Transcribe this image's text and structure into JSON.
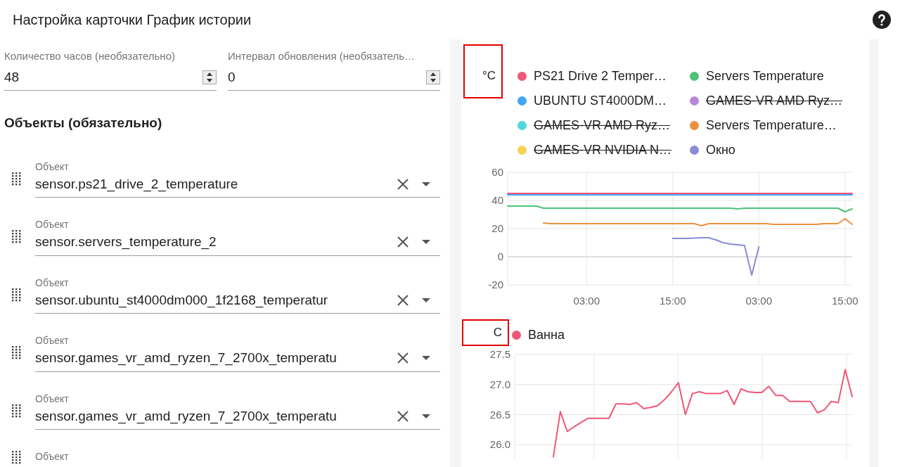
{
  "header": {
    "title": "Настройка карточки График истории"
  },
  "fields": [
    {
      "label": "Количество часов (необязательно)",
      "value": "48"
    },
    {
      "label": "Интервал обновления (необязатель…",
      "value": "0"
    }
  ],
  "entities_heading": "Объекты (обязательно)",
  "entities": [
    {
      "label": "Объект",
      "value": "sensor.ps21_drive_2_temperature"
    },
    {
      "label": "Объект",
      "value": "sensor.servers_temperature_2"
    },
    {
      "label": "Объект",
      "value": "sensor.ubuntu_st4000dm000_1f2168_temperatur"
    },
    {
      "label": "Объект",
      "value": "sensor.games_vr_amd_ryzen_7_2700x_temperatu"
    },
    {
      "label": "Объект",
      "value": "sensor.games_vr_amd_ryzen_7_2700x_temperatu"
    },
    {
      "label": "Объект"
    }
  ],
  "charts": [
    {
      "unit": "°C",
      "unit_highlighted": true,
      "legend": [
        {
          "name": "PS21 Drive 2 Temper…",
          "color": "#ef5777",
          "hidden": false
        },
        {
          "name": "Servers Temperature",
          "color": "#4cc27a",
          "hidden": false
        },
        {
          "name": "UBUNTU ST4000DM…",
          "color": "#42a5f5",
          "hidden": false
        },
        {
          "name": "GAMES-VR AMD Ryz…",
          "color": "#b888d8",
          "hidden": true
        },
        {
          "name": "GAMES-VR AMD Ryz…",
          "color": "#4dd8dc",
          "hidden": true
        },
        {
          "name": "Servers Temperature…",
          "color": "#e8913f",
          "hidden": false
        },
        {
          "name": "GAMES-VR NVIDIA N…",
          "color": "#f7d154",
          "hidden": true
        },
        {
          "name": "Окно",
          "color": "#8a8ad8",
          "hidden": false
        }
      ],
      "chart_data": {
        "type": "line",
        "categories": [
          null,
          null,
          null,
          null,
          null,
          null,
          null,
          null,
          null,
          null,
          null,
          "03:00",
          null,
          null,
          null,
          null,
          null,
          null,
          null,
          null,
          null,
          null,
          null,
          "15:00",
          null,
          null,
          null,
          null,
          null,
          null,
          null,
          null,
          null,
          null,
          null,
          "03:00",
          null,
          null,
          null,
          null,
          null,
          null,
          null,
          null,
          null,
          null,
          null,
          "15:00",
          null
        ],
        "grid": true,
        "ylim": [
          -20,
          60
        ],
        "yticks": [
          -20,
          0,
          20,
          40,
          60
        ],
        "series": [
          {
            "color": "#ef5777",
            "values": [
              45,
              45,
              45,
              45,
              45,
              45,
              45,
              45,
              45,
              45,
              45,
              45,
              45,
              45,
              45,
              45,
              45,
              45,
              45,
              45,
              45,
              45,
              45,
              45,
              45,
              45,
              45,
              45,
              45,
              45,
              45,
              45,
              45,
              45,
              45,
              45,
              45,
              45,
              45,
              45,
              45,
              45,
              45,
              45,
              45,
              45,
              45,
              45,
              45
            ]
          },
          {
            "color": "#42a5f5",
            "values": [
              44,
              44,
              44,
              44,
              44,
              44,
              44,
              44,
              44,
              44,
              44,
              44,
              44,
              44,
              44,
              44,
              44,
              44,
              44,
              44,
              44,
              44,
              44,
              44,
              44,
              44,
              44,
              44,
              44,
              44,
              44,
              44,
              44,
              44,
              44,
              44,
              44,
              44,
              44,
              44,
              44,
              44,
              44,
              44,
              44,
              44,
              44,
              44,
              44
            ]
          },
          {
            "color": "#4cc27a",
            "values": [
              36,
              36,
              36,
              36,
              36,
              34.5,
              34.5,
              34.5,
              34.5,
              34.5,
              34.5,
              34.5,
              34.5,
              34.5,
              34.5,
              34.5,
              34.5,
              34.5,
              34.5,
              34.5,
              34.5,
              34.5,
              34.5,
              34.5,
              34.5,
              34.5,
              34.5,
              34.5,
              34.5,
              34.5,
              34.5,
              34.5,
              34,
              34.5,
              34.5,
              34.5,
              34.5,
              34.5,
              34.5,
              34.5,
              34.5,
              34.5,
              34.5,
              34.5,
              34.5,
              34.5,
              34.5,
              32,
              34
            ]
          },
          {
            "color": "#e8913f",
            "values": [
              null,
              null,
              null,
              null,
              null,
              24,
              23.5,
              23.5,
              23.5,
              23.5,
              23.5,
              23.5,
              23.5,
              23.5,
              23.5,
              23.5,
              23.5,
              23.5,
              23.5,
              23.5,
              23.5,
              23.5,
              23.5,
              23.5,
              23.5,
              23.5,
              23.5,
              22,
              23.5,
              23.5,
              23.5,
              23.5,
              23.5,
              23.5,
              23.5,
              23.5,
              23.5,
              23,
              23,
              23,
              23,
              23,
              23,
              23,
              23.5,
              23.5,
              23.5,
              27,
              23
            ]
          },
          {
            "color": "#8a8ad8",
            "values": [
              null,
              null,
              null,
              null,
              null,
              null,
              null,
              null,
              null,
              null,
              null,
              null,
              null,
              null,
              null,
              null,
              null,
              null,
              null,
              null,
              null,
              null,
              null,
              13,
              13,
              13,
              13.3,
              13.5,
              13.5,
              12,
              10,
              9,
              8.5,
              8,
              -13,
              7,
              null,
              null,
              null,
              null,
              null,
              null,
              null,
              null,
              null,
              null,
              null,
              null,
              null
            ]
          }
        ]
      }
    },
    {
      "unit": "C",
      "unit_highlighted": true,
      "legend": [
        {
          "name": "Ванна",
          "color": "#ef5777",
          "hidden": false
        }
      ],
      "chart_data": {
        "type": "line",
        "categories": [
          null,
          null,
          null,
          null,
          null,
          null,
          null,
          null,
          null,
          null,
          null,
          null,
          null,
          null,
          null,
          null,
          null,
          null,
          null,
          null,
          null,
          null,
          null,
          null,
          null,
          null,
          null,
          null,
          null,
          null,
          null,
          null,
          null,
          null,
          null,
          null,
          null,
          null,
          null,
          null,
          null,
          null,
          null,
          null
        ],
        "grid": true,
        "ylim": [
          25.77,
          27.5
        ],
        "yticks": [
          {
            "value": 26,
            "label": "26.0"
          },
          {
            "value": 26.5,
            "label": "26.5"
          },
          {
            "value": 27,
            "label": "27.0"
          },
          {
            "value": 27.5,
            "label": "27.5"
          }
        ],
        "series": [
          {
            "color": "#ef5777",
            "values": [
              25.8,
              26.55,
              26.22,
              26.3,
              26.37,
              26.44,
              26.44,
              26.44,
              26.44,
              26.68,
              26.68,
              26.67,
              26.7,
              26.6,
              26.62,
              26.65,
              26.75,
              26.88,
              27.03,
              26.5,
              26.85,
              26.88,
              26.85,
              26.85,
              26.85,
              26.9,
              26.67,
              26.93,
              26.88,
              26.87,
              26.87,
              26.97,
              26.82,
              26.82,
              26.72,
              26.72,
              26.72,
              26.72,
              26.53,
              26.58,
              26.72,
              26.7,
              27.25,
              26.8
            ]
          }
        ]
      }
    }
  ]
}
